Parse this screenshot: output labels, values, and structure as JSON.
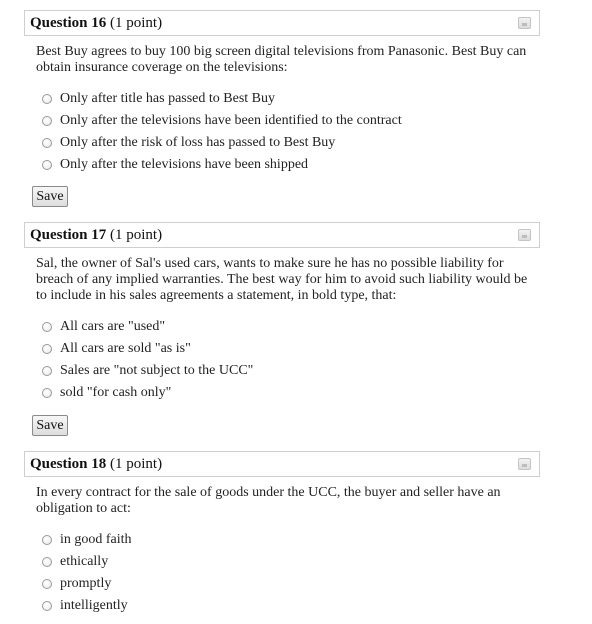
{
  "questions": [
    {
      "number_label": "Question 16",
      "points_label": "(1 point)",
      "text": "Best Buy agrees to buy 100 big screen digital televisions from Panasonic. Best Buy can obtain insurance coverage on the televisions:",
      "options": [
        "Only after title has passed to Best Buy",
        "Only after the televisions have been identified to the contract",
        "Only after the risk of loss has passed to Best Buy",
        "Only after the televisions have been shipped"
      ],
      "save_label": "Save"
    },
    {
      "number_label": "Question 17",
      "points_label": "(1 point)",
      "text": "Sal, the owner of Sal's used cars, wants to make sure he has no possible liability for breach of any implied warranties. The best way for him to avoid such liability would be to include in his sales agreements a statement, in bold type, that:",
      "options": [
        "All cars are \"used\"",
        "All cars are sold \"as is\"",
        "Sales are \"not subject to the UCC\"",
        "sold \"for cash only\""
      ],
      "save_label": "Save"
    },
    {
      "number_label": "Question 18",
      "points_label": "(1 point)",
      "text": "In every contract for the sale of goods under the UCC, the buyer and seller have an obligation to act:",
      "options": [
        "in good faith",
        "ethically",
        "promptly",
        "intelligently"
      ]
    }
  ]
}
